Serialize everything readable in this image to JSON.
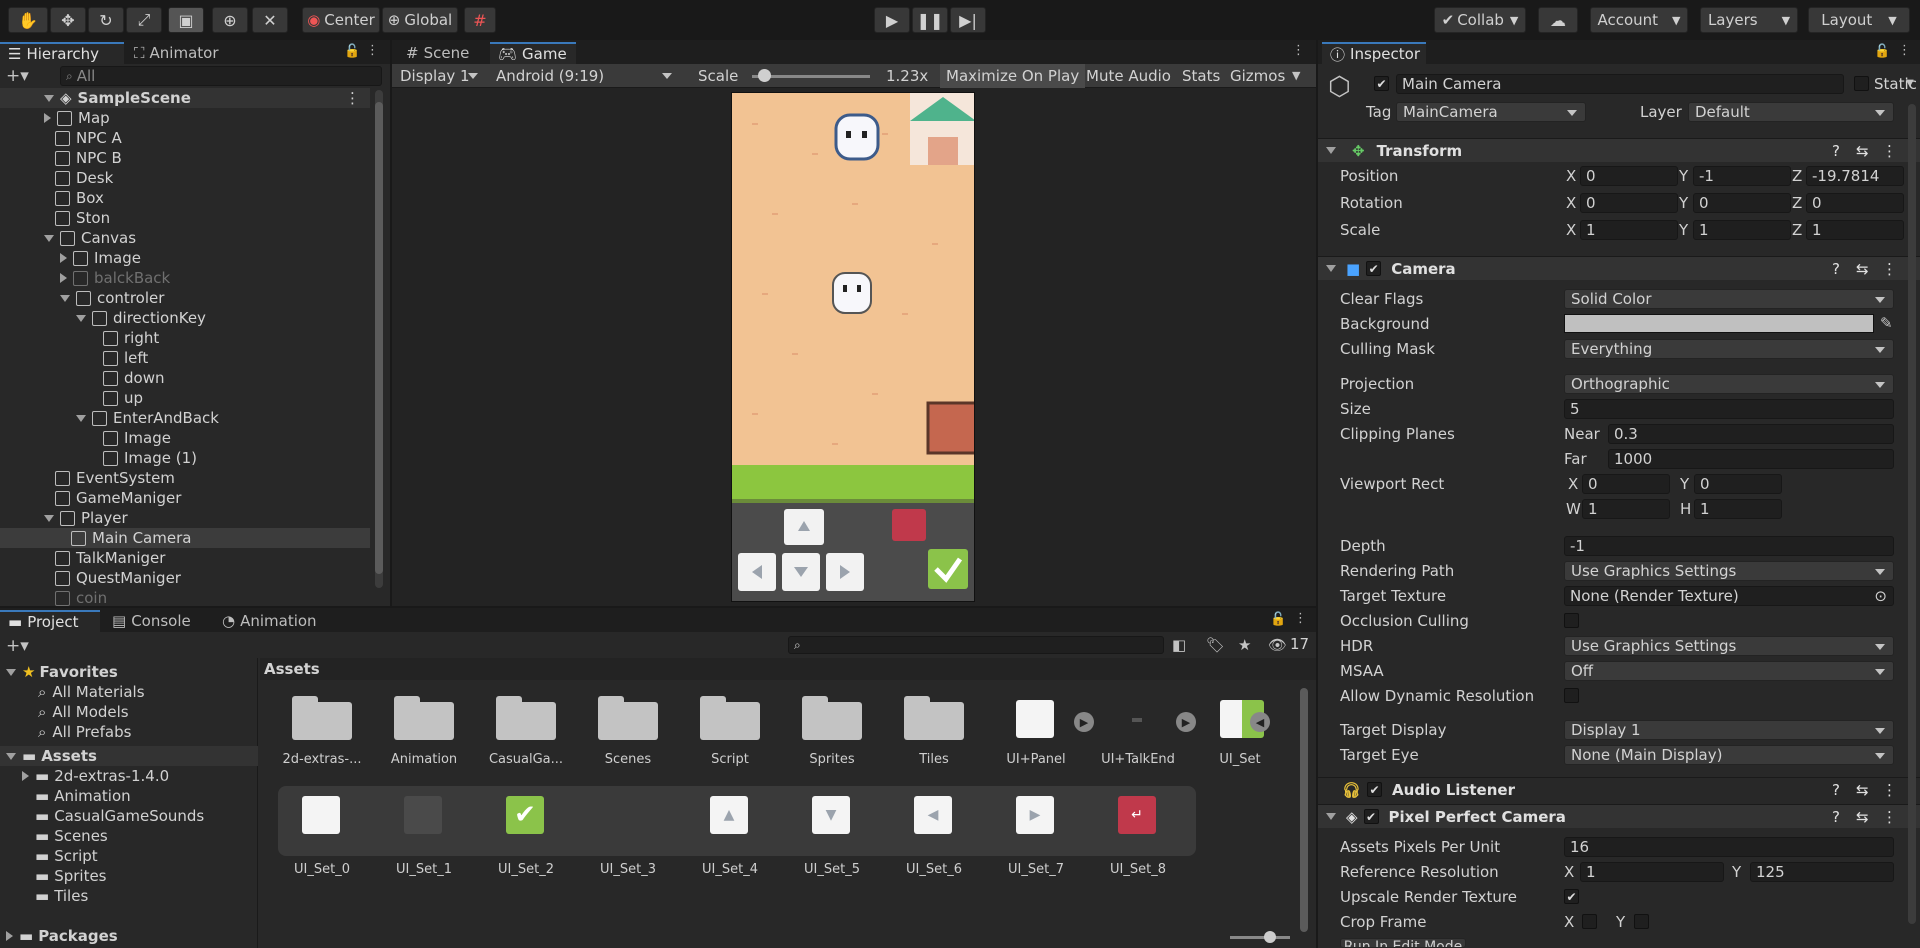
{
  "toolbar": {
    "pivot": "Center",
    "space": "Global",
    "collab": "Collab",
    "account": "Account",
    "layers": "Layers",
    "layout": "Layout"
  },
  "hierarchy": {
    "tabs": [
      "Hierarchy",
      "Animator"
    ],
    "search_placeholder": "All",
    "scene": "SampleScene",
    "items": [
      {
        "label": "Map",
        "depth": 1,
        "arrow": "closed"
      },
      {
        "label": "NPC A",
        "depth": 1,
        "arrow": ""
      },
      {
        "label": "NPC B",
        "depth": 1,
        "arrow": ""
      },
      {
        "label": "Desk",
        "depth": 1,
        "arrow": ""
      },
      {
        "label": "Box",
        "depth": 1,
        "arrow": ""
      },
      {
        "label": "Ston",
        "depth": 1,
        "arrow": ""
      },
      {
        "label": "Canvas",
        "depth": 1,
        "arrow": "open"
      },
      {
        "label": "Image",
        "depth": 2,
        "arrow": "closed"
      },
      {
        "label": "balckBack",
        "depth": 2,
        "arrow": "closed",
        "dim": true
      },
      {
        "label": "controler",
        "depth": 2,
        "arrow": "open"
      },
      {
        "label": "directionKey",
        "depth": 3,
        "arrow": "open"
      },
      {
        "label": "right",
        "depth": 4,
        "arrow": ""
      },
      {
        "label": "left",
        "depth": 4,
        "arrow": ""
      },
      {
        "label": "down",
        "depth": 4,
        "arrow": ""
      },
      {
        "label": "up",
        "depth": 4,
        "arrow": ""
      },
      {
        "label": "EnterAndBack",
        "depth": 3,
        "arrow": "open"
      },
      {
        "label": "Image",
        "depth": 4,
        "arrow": ""
      },
      {
        "label": "Image (1)",
        "depth": 4,
        "arrow": ""
      },
      {
        "label": "EventSystem",
        "depth": 1,
        "arrow": ""
      },
      {
        "label": "GameManiger",
        "depth": 1,
        "arrow": ""
      },
      {
        "label": "Player",
        "depth": 1,
        "arrow": "open"
      },
      {
        "label": "Main Camera",
        "depth": 2,
        "arrow": "",
        "selected": true
      },
      {
        "label": "TalkManiger",
        "depth": 1,
        "arrow": ""
      },
      {
        "label": "QuestManiger",
        "depth": 1,
        "arrow": ""
      },
      {
        "label": "coin",
        "depth": 1,
        "arrow": "",
        "dim": true
      }
    ]
  },
  "game": {
    "tabs": [
      "Scene",
      "Game"
    ],
    "display": "Display 1",
    "aspect": "Android (9:19)",
    "scale_label": "Scale",
    "scale_value": "1.23x",
    "maximize": "Maximize On Play",
    "mute": "Mute Audio",
    "stats": "Stats",
    "gizmos": "Gizmos"
  },
  "inspector": {
    "tab": "Inspector",
    "object_name": "Main Camera",
    "static": "Static",
    "tag_label": "Tag",
    "tag": "MainCamera",
    "layer_label": "Layer",
    "layer": "Default",
    "transform": {
      "title": "Transform",
      "position_label": "Position",
      "px": "0",
      "py": "-1",
      "pz": "-19.7814",
      "rotation_label": "Rotation",
      "rx": "0",
      "ry": "0",
      "rz": "0",
      "scale_label": "Scale",
      "sx": "1",
      "sy": "1",
      "sz": "1"
    },
    "camera": {
      "title": "Camera",
      "clear_flags_label": "Clear Flags",
      "clear_flags": "Solid Color",
      "background_label": "Background",
      "culling_label": "Culling Mask",
      "culling": "Everything",
      "projection_label": "Projection",
      "projection": "Orthographic",
      "size_label": "Size",
      "size": "5",
      "clipping_label": "Clipping Planes",
      "near_label": "Near",
      "near": "0.3",
      "far_label": "Far",
      "far": "1000",
      "viewport_label": "Viewport Rect",
      "vx": "0",
      "vy": "0",
      "vw": "1",
      "vh": "1",
      "depth_label": "Depth",
      "depth": "-1",
      "rendering_label": "Rendering Path",
      "rendering": "Use Graphics Settings",
      "target_texture_label": "Target Texture",
      "target_texture": "None (Render Texture)",
      "occlusion_label": "Occlusion Culling",
      "hdr_label": "HDR",
      "hdr": "Use Graphics Settings",
      "msaa_label": "MSAA",
      "msaa": "Off",
      "dynres_label": "Allow Dynamic Resolution",
      "target_display_label": "Target Display",
      "target_display": "Display 1",
      "target_eye_label": "Target Eye",
      "target_eye": "None (Main Display)"
    },
    "audio": {
      "title": "Audio Listener"
    },
    "ppc": {
      "title": "Pixel Perfect Camera",
      "ppu_label": "Assets Pixels Per Unit",
      "ppu": "16",
      "refres_label": "Reference Resolution",
      "rx": "1",
      "ry": "125",
      "upscale_label": "Upscale Render Texture",
      "crop_label": "Crop Frame",
      "run_edit": "Run In Edit Mode"
    }
  },
  "project": {
    "tabs": [
      "Project",
      "Console",
      "Animation"
    ],
    "hidden_count": "17",
    "favorites": "Favorites",
    "fav_items": [
      "All Materials",
      "All Models",
      "All Prefabs"
    ],
    "assets": "Assets",
    "asset_folders": [
      "2d-extras-1.4.0",
      "Animation",
      "CasualGameSounds",
      "Scenes",
      "Script",
      "Sprites",
      "Tiles"
    ],
    "packages": "Packages",
    "breadcrumb": "Assets",
    "grid_row1": [
      "2d-extras-...",
      "Animation",
      "CasualGa...",
      "Scenes",
      "Script",
      "Sprites",
      "Tiles",
      "UI+Panel",
      "UI+TalkEnd",
      "UI_Set"
    ],
    "grid_row2": [
      "UI_Set_0",
      "UI_Set_1",
      "UI_Set_2",
      "UI_Set_3",
      "UI_Set_4",
      "UI_Set_5",
      "UI_Set_6",
      "UI_Set_7",
      "UI_Set_8"
    ]
  },
  "colors": {
    "accent": "#3a79bb",
    "selected": "#2c5d87",
    "sand": "#f4c699",
    "grass": "#8cc63f",
    "green": "#8bc34a",
    "red": "#c0394b"
  }
}
